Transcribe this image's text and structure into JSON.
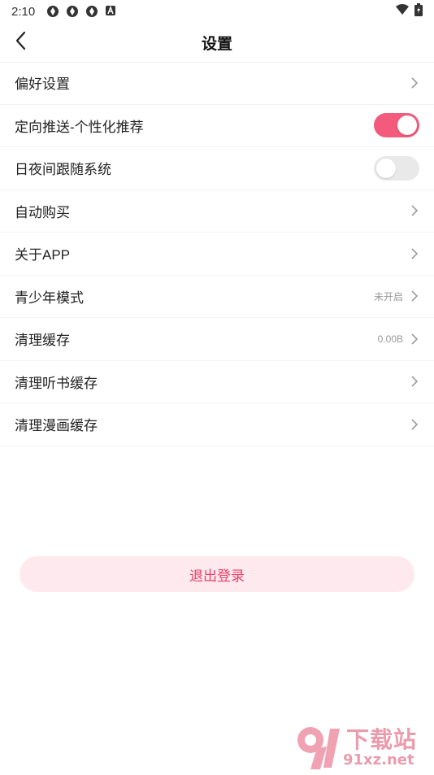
{
  "status_bar": {
    "time": "2:10",
    "notification_icons": [
      "app-notification-icon",
      "app-notification-icon",
      "app-notification-icon",
      "a-notification-icon"
    ],
    "right_icons": [
      "wifi-icon",
      "battery-icon"
    ]
  },
  "header": {
    "title": "设置",
    "back_icon": "chevron-left-icon"
  },
  "settings": [
    {
      "label": "偏好设置",
      "type": "nav"
    },
    {
      "label": "定向推送-个性化推荐",
      "type": "toggle",
      "on": true
    },
    {
      "label": "日夜间跟随系统",
      "type": "toggle",
      "on": false
    },
    {
      "label": "自动购买",
      "type": "nav"
    },
    {
      "label": "关于APP",
      "type": "nav"
    },
    {
      "label": "青少年模式",
      "type": "nav",
      "value": "未开启"
    },
    {
      "label": "清理缓存",
      "type": "nav",
      "value": "0.00B"
    },
    {
      "label": "清理听书缓存",
      "type": "nav"
    },
    {
      "label": "清理漫画缓存",
      "type": "nav"
    }
  ],
  "logout": {
    "label": "退出登录"
  },
  "watermark": {
    "top": "下载站",
    "bottom": "91xz.net"
  },
  "colors": {
    "accent": "#f25b7c",
    "logout_bg": "#fde9ee",
    "logout_text": "#ee3f66",
    "toggle_off": "#e9e9e9",
    "muted_text": "#999999"
  }
}
